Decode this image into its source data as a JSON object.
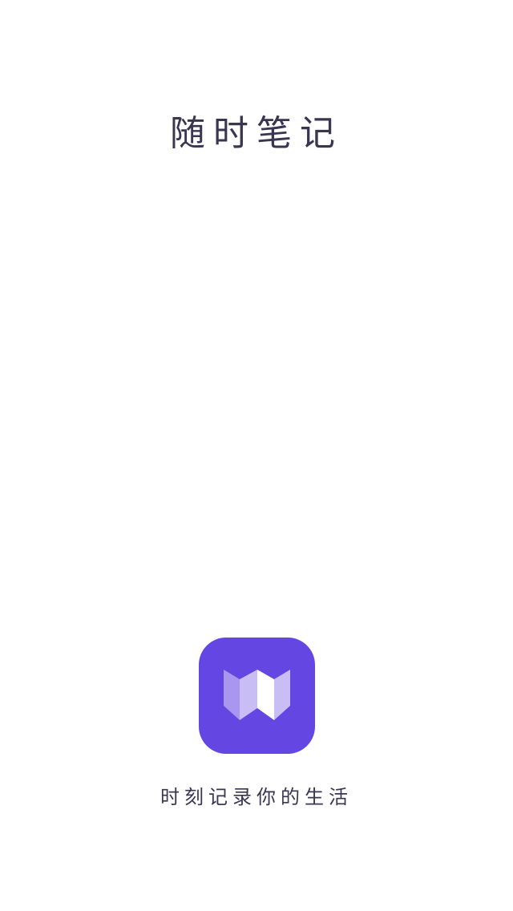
{
  "splash": {
    "title": "随时笔记",
    "slogan": "时刻记录你的生活",
    "logo_icon": "app-logo-w-icon",
    "colors": {
      "background": "#ffffff",
      "text": "#3a3550",
      "logo_background": "#6446e2",
      "logo_light": "#c9bdf6",
      "logo_mid": "#a996ef",
      "logo_white": "#ffffff"
    }
  }
}
